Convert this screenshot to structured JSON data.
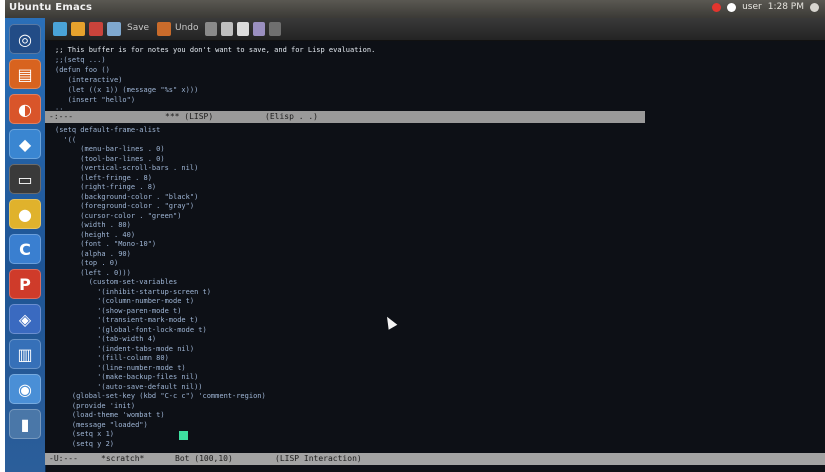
{
  "window": {
    "title": "Ubuntu Emacs"
  },
  "tray": {
    "time": "1:28 PM",
    "user": "user"
  },
  "launcher": {
    "items": [
      {
        "name": "dash",
        "glyph": "◎",
        "color": "#224c86"
      },
      {
        "name": "files",
        "glyph": "▤",
        "color": "#d8631f"
      },
      {
        "name": "firefox",
        "glyph": "◐",
        "color": "#d9552a"
      },
      {
        "name": "app-3",
        "glyph": "◆",
        "color": "#3a86d1"
      },
      {
        "name": "terminal",
        "glyph": "▭",
        "color": "#3a3a3a"
      },
      {
        "name": "chrome",
        "glyph": "●",
        "color": "#e0b22c"
      },
      {
        "name": "app-6",
        "glyph": "C",
        "color": "#3a7fd0"
      },
      {
        "name": "presentation",
        "glyph": "P",
        "color": "#cf3b2a"
      },
      {
        "name": "app-8",
        "glyph": "◈",
        "color": "#3a6ac0"
      },
      {
        "name": "editor",
        "glyph": "▥",
        "color": "#3670b8"
      },
      {
        "name": "app-10",
        "glyph": "◉",
        "color": "#4a8fd6"
      },
      {
        "name": "trash",
        "glyph": "▮",
        "color": "#4a77a8"
      }
    ]
  },
  "toolbar": {
    "left_label": "Save",
    "right_label": "Undo"
  },
  "status_top": {
    "left": "-:---",
    "mid": "*** (LISP)",
    "right": "(Elisp . .)"
  },
  "status_bottom": {
    "left": "-U:---",
    "file": "*scratch*",
    "pos": "Bot (100,10)",
    "mode": "(LISP Interaction)"
  },
  "code_lines": [
    {
      "t": ";; This buffer is for notes you don't want to save, and for Lisp evaluation.",
      "hl": true
    },
    {
      "t": ";;(setq ...)",
      "hl": false
    },
    {
      "t": "(defun foo ()",
      "hl": false
    },
    {
      "t": "   (interactive)",
      "hl": false
    },
    {
      "t": "   (let ((x 1)) (message \"%s\" x)))",
      "hl": false
    },
    {
      "t": "   (insert \"hello\")",
      "hl": false
    },
    {
      "t": ";; ... ",
      "hl": false
    }
  ],
  "body_lines": [
    {
      "t": "(setq default-frame-alist",
      "hl": false
    },
    {
      "t": "  '((",
      "hl": false
    },
    {
      "t": "      (menu-bar-lines . 0)",
      "hl": false
    },
    {
      "t": "      (tool-bar-lines . 0)",
      "hl": false
    },
    {
      "t": "      (vertical-scroll-bars . nil)",
      "hl": false
    },
    {
      "t": "      (left-fringe . 8)",
      "hl": false
    },
    {
      "t": "      (right-fringe . 8)",
      "hl": false
    },
    {
      "t": "      (background-color . \"black\")",
      "hl": false
    },
    {
      "t": "      (foreground-color . \"gray\")",
      "hl": false
    },
    {
      "t": "      (cursor-color . \"green\")",
      "hl": false
    },
    {
      "t": "      (width . 80)",
      "hl": false
    },
    {
      "t": "      (height . 40)",
      "hl": false
    },
    {
      "t": "      (font . \"Mono-10\")",
      "hl": false
    },
    {
      "t": "      (alpha . 90)",
      "hl": false
    },
    {
      "t": "      (top . 0)",
      "hl": false
    },
    {
      "t": "      (left . 0)))",
      "hl": false
    },
    {
      "t": "        (custom-set-variables",
      "hl": false
    },
    {
      "t": "          '(inhibit-startup-screen t)",
      "hl": false
    },
    {
      "t": "          '(column-number-mode t)",
      "hl": false
    },
    {
      "t": "          '(show-paren-mode t)",
      "hl": false
    },
    {
      "t": "          '(transient-mark-mode t)",
      "hl": false
    },
    {
      "t": "          '(global-font-lock-mode t)",
      "hl": false
    },
    {
      "t": "          '(tab-width 4)",
      "hl": false
    },
    {
      "t": "          '(indent-tabs-mode nil)",
      "hl": false
    },
    {
      "t": "          '(fill-column 80)",
      "hl": false
    },
    {
      "t": "          '(line-number-mode t)",
      "hl": false
    },
    {
      "t": "          '(make-backup-files nil)",
      "hl": false
    },
    {
      "t": "          '(auto-save-default nil))",
      "hl": false
    },
    {
      "t": "    (global-set-key (kbd \"C-c c\") 'comment-region)",
      "hl": false
    },
    {
      "t": "    (provide 'init)",
      "hl": false
    },
    {
      "t": "    (load-theme 'wombat t)",
      "hl": false
    },
    {
      "t": "    (message \"loaded\")",
      "hl": false
    },
    {
      "t": "    (setq x 1)",
      "hl": false
    },
    {
      "t": "    (setq y 2)",
      "hl": false
    }
  ]
}
